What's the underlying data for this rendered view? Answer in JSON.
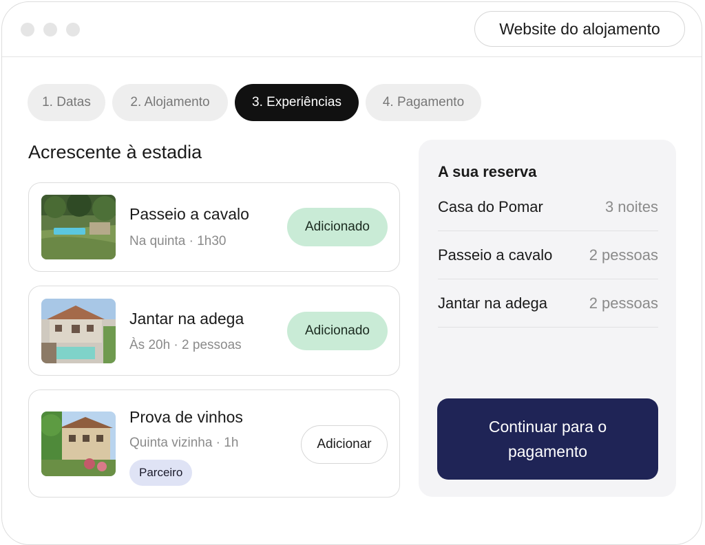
{
  "window": {
    "site_button": "Website do alojamento"
  },
  "steps": [
    {
      "label": "1. Datas",
      "active": false
    },
    {
      "label": "2. Alojamento",
      "active": false
    },
    {
      "label": "3. Experiências",
      "active": true
    },
    {
      "label": "4. Pagamento",
      "active": false
    }
  ],
  "extras": {
    "heading": "Acrescente à estadia",
    "items": [
      {
        "title": "Passeio a cavalo",
        "subtitle": "Na quinta · 1h30",
        "button": "Adicionado",
        "state": "added"
      },
      {
        "title": "Jantar na adega",
        "subtitle": "Às 20h · 2 pessoas",
        "button": "Adicionado",
        "state": "added"
      },
      {
        "title": "Prova de vinhos",
        "subtitle": "Quinta vizinha · 1h",
        "button": "Adicionar",
        "state": "not-added",
        "badge": "Parceiro"
      }
    ]
  },
  "summary": {
    "title": "A sua reserva",
    "rows": [
      {
        "label": "Casa do Pomar",
        "value": "3 noites"
      },
      {
        "label": "Passeio a cavalo",
        "value": "2 pessoas"
      },
      {
        "label": "Jantar na adega",
        "value": "2 pessoas"
      }
    ],
    "cta": "Continuar para o pagamento"
  },
  "colors": {
    "active_step": "#111111",
    "added": "#c9ebd6",
    "badge": "#dfe3f5",
    "cta": "#1f2456",
    "panel": "#f4f4f6"
  }
}
